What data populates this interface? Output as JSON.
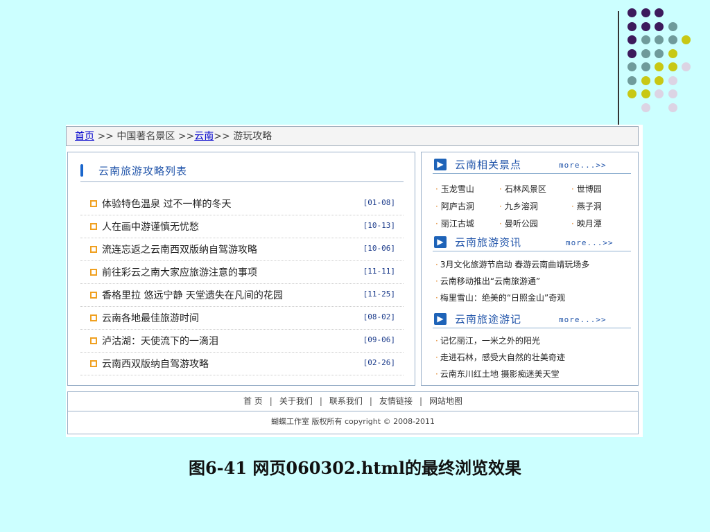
{
  "breadcrumb": {
    "home": "首页",
    "sep1": ">>",
    "famous": "中国著名景区",
    "sep2": ">>",
    "region": "云南",
    "sep3": ">>",
    "current": "游玩攻略"
  },
  "list": {
    "title": "云南旅游攻略列表",
    "items": [
      {
        "title": "体验特色温泉 过不一样的冬天",
        "date": "[01-08]"
      },
      {
        "title": "人在画中游谨慎无忧愁",
        "date": "[10-13]"
      },
      {
        "title": "流连忘返之云南西双版纳自驾游攻略",
        "date": "[10-06]"
      },
      {
        "title": "前往彩云之南大家应旅游注意的事项",
        "date": "[11-11]"
      },
      {
        "title": "香格里拉 悠远宁静 天堂遗失在凡间的花园",
        "date": "[11-25]"
      },
      {
        "title": "云南各地最佳旅游时间",
        "date": "[08-02]"
      },
      {
        "title": "泸沽湖：天使流下的一滴泪",
        "date": "[09-06]"
      },
      {
        "title": "云南西双版纳自驾游攻略",
        "date": "[02-26]"
      }
    ]
  },
  "spots": {
    "title": "云南相关景点",
    "more": "more...>>",
    "links": [
      "玉龙雪山",
      "石林风景区",
      "世博园",
      "阿庐古洞",
      "九乡溶洞",
      "燕子洞",
      "丽江古城",
      "曼听公园",
      "映月潭"
    ]
  },
  "news": {
    "title": "云南旅游资讯",
    "more": "more...>>",
    "links": [
      "3月文化旅游节启动 春游云南曲靖玩场多",
      "云南移动推出“云南旅游通”",
      "梅里雪山：绝美的“日照金山”奇观"
    ]
  },
  "travelogue": {
    "title": "云南旅途游记",
    "more": "more...>>",
    "links": [
      "记忆丽江，一米之外的阳光",
      "走进石林，感受大自然的壮美奇迹",
      "云南东川红土地 摄影痴迷美天堂"
    ]
  },
  "footer": {
    "nav": [
      "首 页",
      "关于我们",
      "联系我们",
      "友情链接",
      "网站地图"
    ],
    "sep": "|",
    "copyright": "蝴蝶工作室 版权所有 copyright © 2008-2011"
  },
  "caption": "图6-41   网页060302.html的最终浏览效果",
  "colors": {
    "background": "#ccffff",
    "accent_blue": "#2255aa",
    "bullet_orange": "#f0a020",
    "dot_purple": "#3d1a5c",
    "dot_teal": "#6f9b9b",
    "dot_yellow": "#c8c814",
    "dot_lilac": "#dcd4e4"
  }
}
